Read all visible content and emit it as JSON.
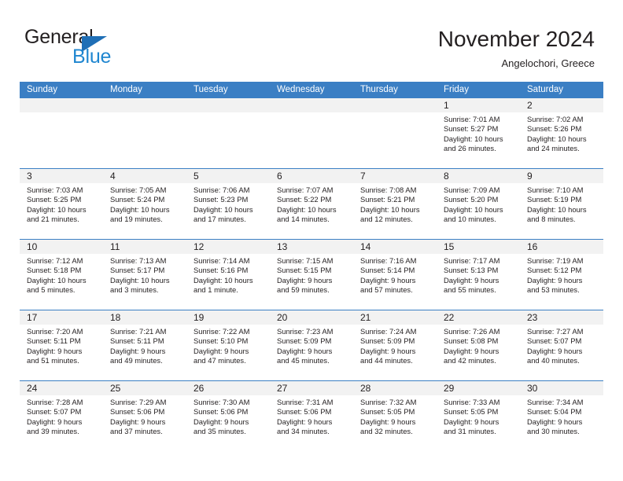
{
  "brand": {
    "name_part1": "General",
    "name_part2": "Blue"
  },
  "header": {
    "title": "November 2024",
    "subtitle": "Angelochori, Greece"
  },
  "colors": {
    "header_blue": "#3b7fc4",
    "logo_blue": "#1f86d0",
    "day_band_gray": "#f2f2f2",
    "text": "#231f20"
  },
  "weekday_headers": [
    "Sunday",
    "Monday",
    "Tuesday",
    "Wednesday",
    "Thursday",
    "Friday",
    "Saturday"
  ],
  "labels": {
    "sunrise": "Sunrise:",
    "sunset": "Sunset:",
    "daylight": "Daylight:"
  },
  "weeks": [
    [
      {
        "day": "",
        "empty": true
      },
      {
        "day": "",
        "empty": true
      },
      {
        "day": "",
        "empty": true
      },
      {
        "day": "",
        "empty": true
      },
      {
        "day": "",
        "empty": true
      },
      {
        "day": "1",
        "sunrise": "Sunrise: 7:01 AM",
        "sunset": "Sunset: 5:27 PM",
        "daylight_l1": "Daylight: 10 hours",
        "daylight_l2": "and 26 minutes."
      },
      {
        "day": "2",
        "sunrise": "Sunrise: 7:02 AM",
        "sunset": "Sunset: 5:26 PM",
        "daylight_l1": "Daylight: 10 hours",
        "daylight_l2": "and 24 minutes."
      }
    ],
    [
      {
        "day": "3",
        "sunrise": "Sunrise: 7:03 AM",
        "sunset": "Sunset: 5:25 PM",
        "daylight_l1": "Daylight: 10 hours",
        "daylight_l2": "and 21 minutes."
      },
      {
        "day": "4",
        "sunrise": "Sunrise: 7:05 AM",
        "sunset": "Sunset: 5:24 PM",
        "daylight_l1": "Daylight: 10 hours",
        "daylight_l2": "and 19 minutes."
      },
      {
        "day": "5",
        "sunrise": "Sunrise: 7:06 AM",
        "sunset": "Sunset: 5:23 PM",
        "daylight_l1": "Daylight: 10 hours",
        "daylight_l2": "and 17 minutes."
      },
      {
        "day": "6",
        "sunrise": "Sunrise: 7:07 AM",
        "sunset": "Sunset: 5:22 PM",
        "daylight_l1": "Daylight: 10 hours",
        "daylight_l2": "and 14 minutes."
      },
      {
        "day": "7",
        "sunrise": "Sunrise: 7:08 AM",
        "sunset": "Sunset: 5:21 PM",
        "daylight_l1": "Daylight: 10 hours",
        "daylight_l2": "and 12 minutes."
      },
      {
        "day": "8",
        "sunrise": "Sunrise: 7:09 AM",
        "sunset": "Sunset: 5:20 PM",
        "daylight_l1": "Daylight: 10 hours",
        "daylight_l2": "and 10 minutes."
      },
      {
        "day": "9",
        "sunrise": "Sunrise: 7:10 AM",
        "sunset": "Sunset: 5:19 PM",
        "daylight_l1": "Daylight: 10 hours",
        "daylight_l2": "and 8 minutes."
      }
    ],
    [
      {
        "day": "10",
        "sunrise": "Sunrise: 7:12 AM",
        "sunset": "Sunset: 5:18 PM",
        "daylight_l1": "Daylight: 10 hours",
        "daylight_l2": "and 5 minutes."
      },
      {
        "day": "11",
        "sunrise": "Sunrise: 7:13 AM",
        "sunset": "Sunset: 5:17 PM",
        "daylight_l1": "Daylight: 10 hours",
        "daylight_l2": "and 3 minutes."
      },
      {
        "day": "12",
        "sunrise": "Sunrise: 7:14 AM",
        "sunset": "Sunset: 5:16 PM",
        "daylight_l1": "Daylight: 10 hours",
        "daylight_l2": "and 1 minute."
      },
      {
        "day": "13",
        "sunrise": "Sunrise: 7:15 AM",
        "sunset": "Sunset: 5:15 PM",
        "daylight_l1": "Daylight: 9 hours",
        "daylight_l2": "and 59 minutes."
      },
      {
        "day": "14",
        "sunrise": "Sunrise: 7:16 AM",
        "sunset": "Sunset: 5:14 PM",
        "daylight_l1": "Daylight: 9 hours",
        "daylight_l2": "and 57 minutes."
      },
      {
        "day": "15",
        "sunrise": "Sunrise: 7:17 AM",
        "sunset": "Sunset: 5:13 PM",
        "daylight_l1": "Daylight: 9 hours",
        "daylight_l2": "and 55 minutes."
      },
      {
        "day": "16",
        "sunrise": "Sunrise: 7:19 AM",
        "sunset": "Sunset: 5:12 PM",
        "daylight_l1": "Daylight: 9 hours",
        "daylight_l2": "and 53 minutes."
      }
    ],
    [
      {
        "day": "17",
        "sunrise": "Sunrise: 7:20 AM",
        "sunset": "Sunset: 5:11 PM",
        "daylight_l1": "Daylight: 9 hours",
        "daylight_l2": "and 51 minutes."
      },
      {
        "day": "18",
        "sunrise": "Sunrise: 7:21 AM",
        "sunset": "Sunset: 5:11 PM",
        "daylight_l1": "Daylight: 9 hours",
        "daylight_l2": "and 49 minutes."
      },
      {
        "day": "19",
        "sunrise": "Sunrise: 7:22 AM",
        "sunset": "Sunset: 5:10 PM",
        "daylight_l1": "Daylight: 9 hours",
        "daylight_l2": "and 47 minutes."
      },
      {
        "day": "20",
        "sunrise": "Sunrise: 7:23 AM",
        "sunset": "Sunset: 5:09 PM",
        "daylight_l1": "Daylight: 9 hours",
        "daylight_l2": "and 45 minutes."
      },
      {
        "day": "21",
        "sunrise": "Sunrise: 7:24 AM",
        "sunset": "Sunset: 5:09 PM",
        "daylight_l1": "Daylight: 9 hours",
        "daylight_l2": "and 44 minutes."
      },
      {
        "day": "22",
        "sunrise": "Sunrise: 7:26 AM",
        "sunset": "Sunset: 5:08 PM",
        "daylight_l1": "Daylight: 9 hours",
        "daylight_l2": "and 42 minutes."
      },
      {
        "day": "23",
        "sunrise": "Sunrise: 7:27 AM",
        "sunset": "Sunset: 5:07 PM",
        "daylight_l1": "Daylight: 9 hours",
        "daylight_l2": "and 40 minutes."
      }
    ],
    [
      {
        "day": "24",
        "sunrise": "Sunrise: 7:28 AM",
        "sunset": "Sunset: 5:07 PM",
        "daylight_l1": "Daylight: 9 hours",
        "daylight_l2": "and 39 minutes."
      },
      {
        "day": "25",
        "sunrise": "Sunrise: 7:29 AM",
        "sunset": "Sunset: 5:06 PM",
        "daylight_l1": "Daylight: 9 hours",
        "daylight_l2": "and 37 minutes."
      },
      {
        "day": "26",
        "sunrise": "Sunrise: 7:30 AM",
        "sunset": "Sunset: 5:06 PM",
        "daylight_l1": "Daylight: 9 hours",
        "daylight_l2": "and 35 minutes."
      },
      {
        "day": "27",
        "sunrise": "Sunrise: 7:31 AM",
        "sunset": "Sunset: 5:06 PM",
        "daylight_l1": "Daylight: 9 hours",
        "daylight_l2": "and 34 minutes."
      },
      {
        "day": "28",
        "sunrise": "Sunrise: 7:32 AM",
        "sunset": "Sunset: 5:05 PM",
        "daylight_l1": "Daylight: 9 hours",
        "daylight_l2": "and 32 minutes."
      },
      {
        "day": "29",
        "sunrise": "Sunrise: 7:33 AM",
        "sunset": "Sunset: 5:05 PM",
        "daylight_l1": "Daylight: 9 hours",
        "daylight_l2": "and 31 minutes."
      },
      {
        "day": "30",
        "sunrise": "Sunrise: 7:34 AM",
        "sunset": "Sunset: 5:04 PM",
        "daylight_l1": "Daylight: 9 hours",
        "daylight_l2": "and 30 minutes."
      }
    ]
  ]
}
